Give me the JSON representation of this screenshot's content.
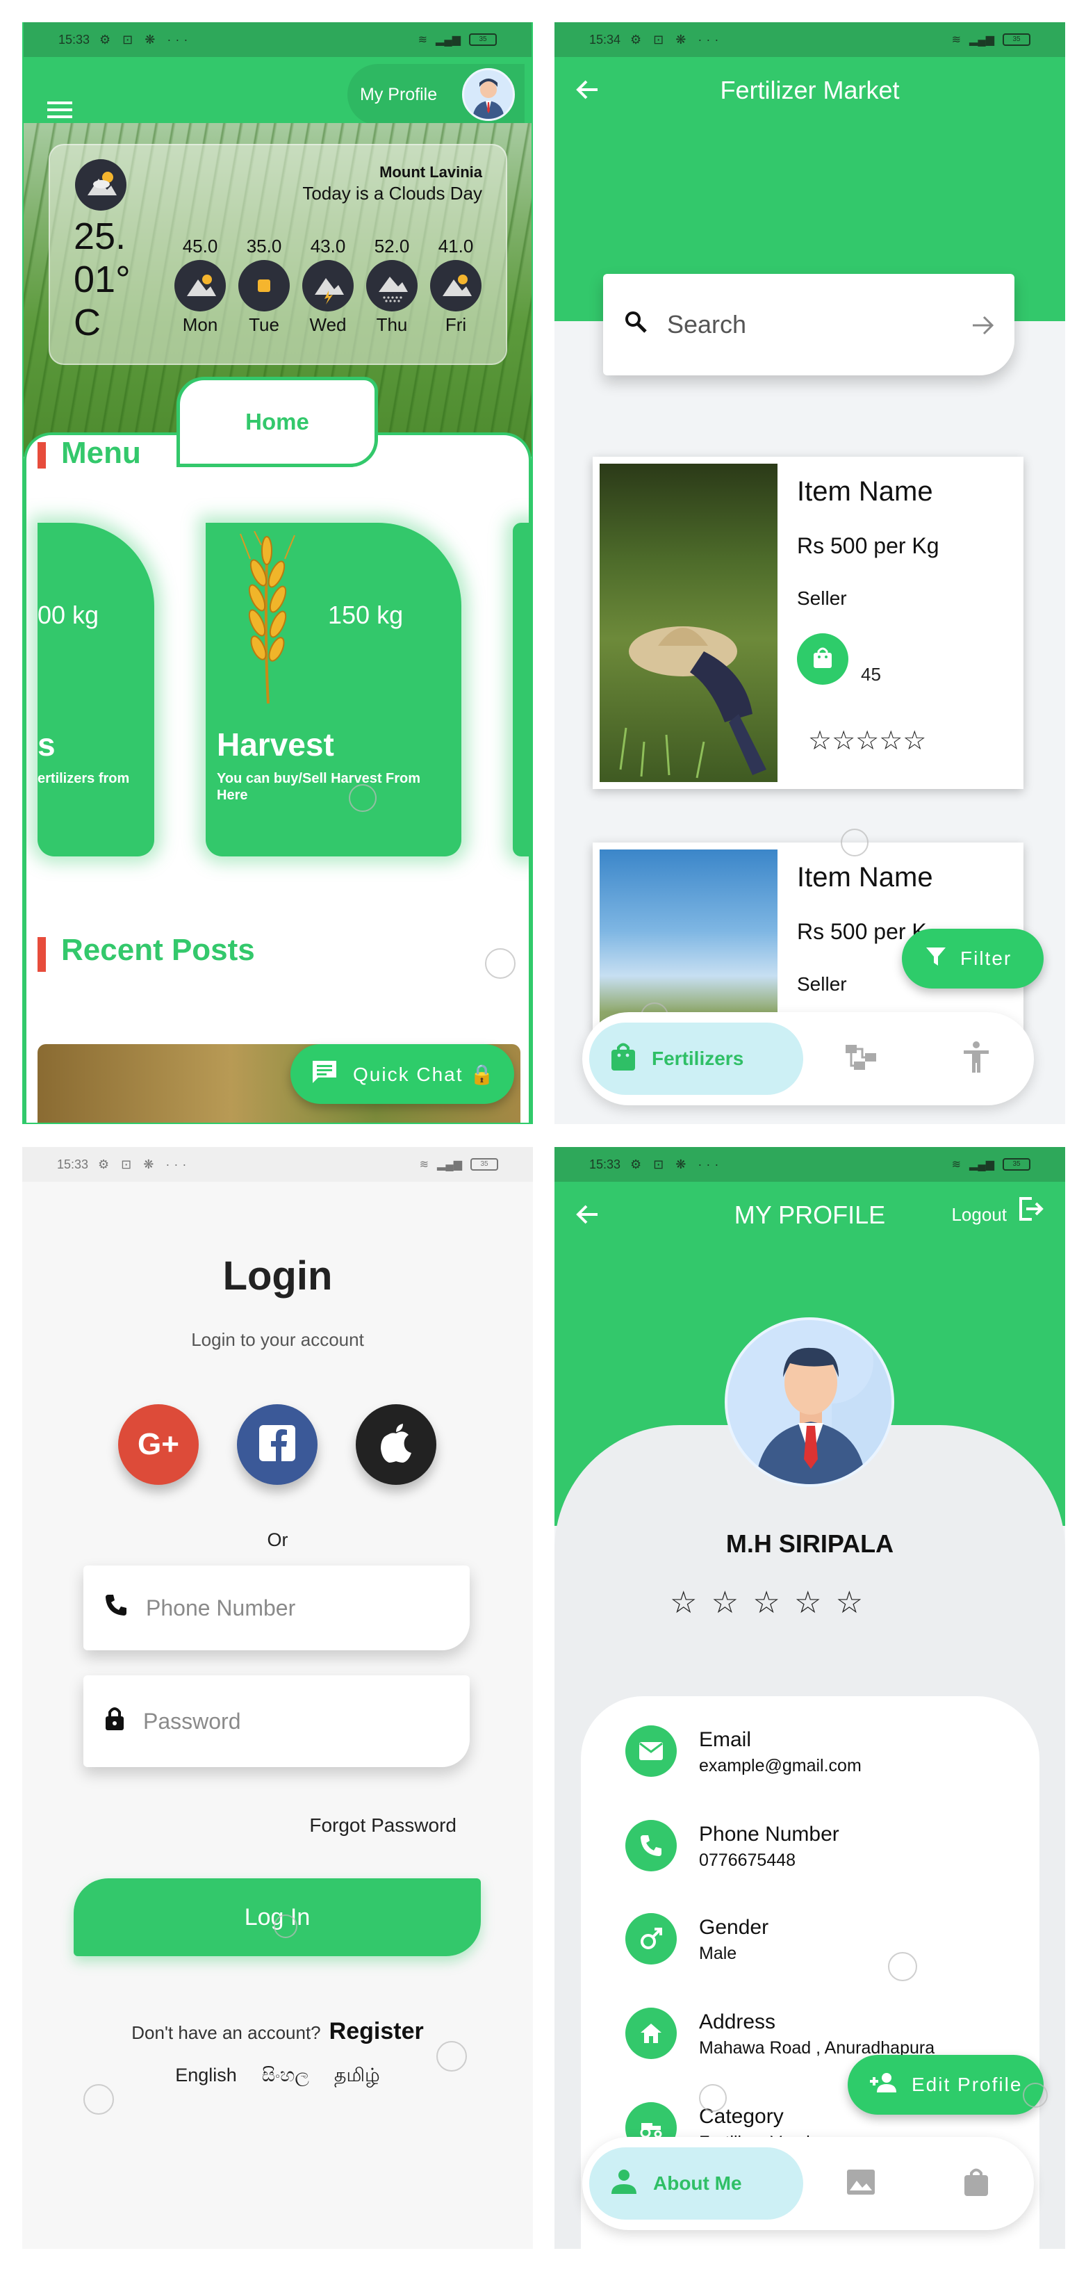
{
  "status": {
    "s1_time": "15:33",
    "s2_time": "15:34",
    "s3_time": "15:33",
    "s4_time": "15:33",
    "battery": "35",
    "icons": "⚙ ⊡ ❋ ···"
  },
  "home": {
    "profile_label": "My Profile",
    "weather": {
      "location": "Mount Lavinia",
      "day_text": "Today is a Clouds Day",
      "temperature": "25.\n01°\nC",
      "days": [
        {
          "name": "Mon",
          "value": "45.0"
        },
        {
          "name": "Tue",
          "value": "35.0"
        },
        {
          "name": "Wed",
          "value": "43.0"
        },
        {
          "name": "Thu",
          "value": "52.0"
        },
        {
          "name": "Fri",
          "value": "41.0"
        }
      ]
    },
    "home_tab": "Home",
    "menu_title": "Menu",
    "cards": [
      {
        "weight": "00 kg",
        "title": "s",
        "desc": "ertilizers from"
      },
      {
        "weight": "150 kg",
        "title": "Harvest",
        "desc": "You can buy/Sell Harvest From Here"
      }
    ],
    "recent_posts_title": "Recent Posts",
    "quick_chat": "Quick Chat 🔒"
  },
  "market": {
    "title": "Fertilizer Market",
    "search_placeholder": "Search",
    "items": [
      {
        "name": "Item Name",
        "price": "Rs 500 per Kg",
        "seller": "Seller",
        "count": "45",
        "stars": "☆☆☆☆☆"
      },
      {
        "name": "Item Name",
        "price": "Rs 500 per K",
        "seller": "Seller"
      }
    ],
    "filter_label": "Filter",
    "nav_active": "Fertilizers"
  },
  "login": {
    "title": "Login",
    "subtitle": "Login to your account",
    "or": "Or",
    "phone_placeholder": "Phone Number",
    "password_placeholder": "Password",
    "forgot": "Forgot Password",
    "button": "Log In",
    "no_account": "Don't have an account?",
    "register": "Register",
    "languages": [
      "English",
      "සිංහල",
      "தமிழ்"
    ]
  },
  "profile": {
    "title": "MY PROFILE",
    "logout": "Logout",
    "name": "M.H SIRIPALA",
    "stars": "☆ ☆ ☆ ☆ ☆",
    "fields": [
      {
        "label": "Email",
        "value": "example@gmail.com",
        "icon": "email-icon"
      },
      {
        "label": "Phone Number",
        "value": "0776675448",
        "icon": "phone-icon"
      },
      {
        "label": "Gender",
        "value": "Male",
        "icon": "gender-icon"
      },
      {
        "label": "Address",
        "value": "Mahawa Road , Anuradhapura",
        "icon": "home-icon"
      },
      {
        "label": "Category",
        "value": "Fertilizer Vendor",
        "icon": "tractor-icon"
      }
    ],
    "edit_label": "Edit Profile",
    "nav_active": "About Me"
  },
  "colors": {
    "primary": "#33c86b",
    "accent_red": "#e74c3c",
    "dark_status": "#2ea85a"
  }
}
